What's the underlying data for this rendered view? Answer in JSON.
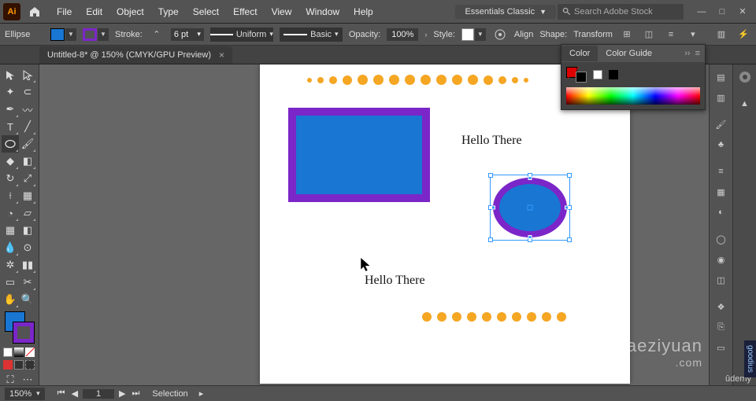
{
  "app": {
    "icon_label": "Ai"
  },
  "menu": {
    "items": [
      "File",
      "Edit",
      "Object",
      "Type",
      "Select",
      "Effect",
      "View",
      "Window",
      "Help"
    ]
  },
  "workspace": {
    "name": "Essentials Classic"
  },
  "search": {
    "placeholder": "Search Adobe Stock"
  },
  "window_controls": {
    "min": "—",
    "max": "□",
    "close": "✕"
  },
  "controlbar": {
    "tool_name": "Ellipse",
    "stroke_label": "Stroke:",
    "stroke_weight": "6 pt",
    "brush_profile": "Uniform",
    "brush_def": "Basic",
    "opacity_label": "Opacity:",
    "opacity_value": "100%",
    "style_label": "Style:",
    "align_label": "Align",
    "shape_label": "Shape:",
    "transform_label": "Transform",
    "fill_color": "#1976d2",
    "stroke_color": "#7b26c9"
  },
  "document": {
    "tab_title": "Untitled-8* @ 150% (CMYK/GPU Preview)"
  },
  "artwork": {
    "text1": "Hello There",
    "text2": "Hello There",
    "dot_color": "#f5a623",
    "rect_fill": "#1976d2",
    "rect_stroke": "#7b26c9",
    "ellipse_fill": "#1976d2",
    "ellipse_stroke": "#7b26c9"
  },
  "panels": {
    "color": {
      "tab1": "Color",
      "tab2": "Color Guide"
    }
  },
  "statusbar": {
    "zoom": "150%",
    "artboard_page": "1",
    "info": "Selection"
  },
  "watermark": {
    "text": "aeziyuan",
    "sub": ".com"
  },
  "branding": {
    "udemy": "ûdemy",
    "sidetag": "goodius"
  }
}
